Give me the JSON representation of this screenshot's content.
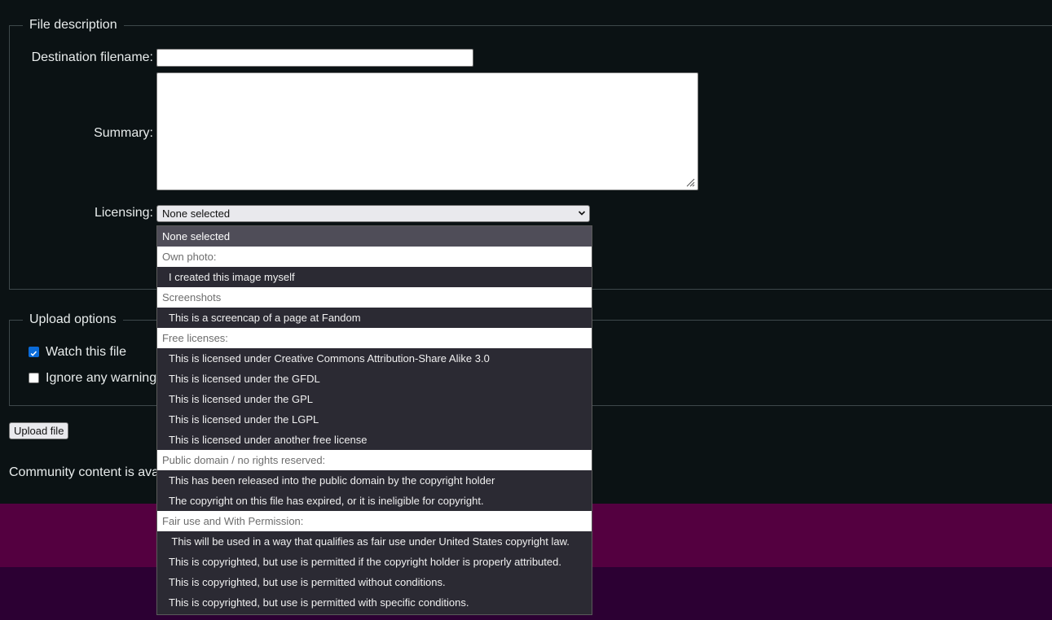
{
  "file_description": {
    "legend": "File description",
    "destination_label": "Destination filename:",
    "destination_value": "",
    "summary_label": "Summary:",
    "summary_value": "",
    "licensing_label": "Licensing:",
    "licensing_selected": "None selected"
  },
  "licensing_options": [
    {
      "type": "selected",
      "label": "None selected"
    },
    {
      "type": "group",
      "label": "Own photo:"
    },
    {
      "type": "item",
      "label": "I created this image myself"
    },
    {
      "type": "group",
      "label": "Screenshots"
    },
    {
      "type": "item",
      "label": "This is a screencap of a page at Fandom"
    },
    {
      "type": "group",
      "label": "Free licenses:"
    },
    {
      "type": "item",
      "label": "This is licensed under Creative Commons Attribution-Share Alike 3.0"
    },
    {
      "type": "item",
      "label": "This is licensed under the GFDL"
    },
    {
      "type": "item",
      "label": "This is licensed under the GPL"
    },
    {
      "type": "item",
      "label": "This is licensed under the LGPL"
    },
    {
      "type": "item",
      "label": "This is licensed under another free license"
    },
    {
      "type": "group",
      "label": "Public domain / no rights reserved:"
    },
    {
      "type": "item",
      "label": "This has been released into the public domain by the copyright holder"
    },
    {
      "type": "item",
      "label": "The copyright on this file has expired, or it is ineligible for copyright."
    },
    {
      "type": "group",
      "label": "Fair use and With Permission:"
    },
    {
      "type": "item",
      "label": " This will be used in a way that qualifies as fair use under United States copyright law."
    },
    {
      "type": "item",
      "label": "This is copyrighted, but use is permitted if the copyright holder is properly attributed."
    },
    {
      "type": "item",
      "label": "This is copyrighted, but use is permitted without conditions."
    },
    {
      "type": "item",
      "label": "This is copyrighted, but use is permitted with specific conditions."
    }
  ],
  "upload_options": {
    "legend": "Upload options",
    "watch_label": "Watch this file",
    "watch_checked": true,
    "ignore_label": "Ignore any warnings",
    "ignore_checked": false
  },
  "upload_button": "Upload file",
  "community_text": "Community content is available under CC-BY-SA unless otherwise noted.",
  "colors": {
    "background": "#0b1214",
    "footer_band_1": "#540040",
    "footer_band_2": "#2c0033",
    "checkbox_accent": "#0a6bd8"
  }
}
